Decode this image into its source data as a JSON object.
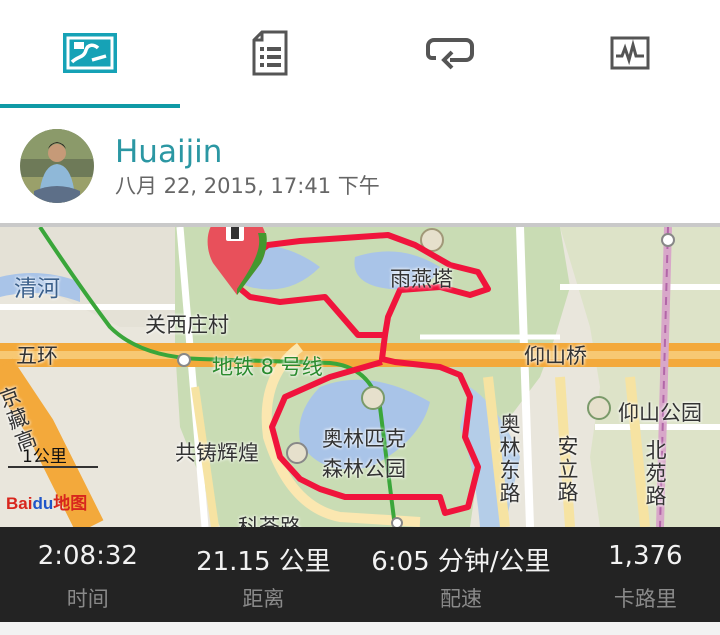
{
  "tabs": [
    {
      "name": "map-tab",
      "icon": "map-icon",
      "active": true
    },
    {
      "name": "details-tab",
      "icon": "document-list-icon",
      "active": false
    },
    {
      "name": "laps-tab",
      "icon": "repeat-icon",
      "active": false
    },
    {
      "name": "chart-tab",
      "icon": "pulse-chart-icon",
      "active": false
    }
  ],
  "header": {
    "user_name": "Huaijin",
    "date": "八月 22, 2015, 17:41 下午"
  },
  "map": {
    "labels": {
      "qinghe": "清河",
      "guanxizhuang": "关西庄村",
      "fifth_ring": "五环",
      "metro8": "地铁 8 号线",
      "yanshanqiao": "仰山桥",
      "yuyanta": "雨燕塔",
      "olympic_park_1": "奥林匹克",
      "olympic_park_2": "森林公园",
      "yangshan_park": "仰山公园",
      "gongzhu": "共铸辉煌",
      "jingzang": "京藏高",
      "aolin_east": "奥林东路",
      "anli": "安立路",
      "beiyuan": "北苑路",
      "kecha": "科荟路"
    },
    "scale": "1公里",
    "provider_logo": "Baidu地图",
    "colors": {
      "route": "#f0143c",
      "metro": "#3aa63a",
      "road": "#f3a93b",
      "pin": "#e8505b"
    }
  },
  "stats": [
    {
      "value": "2:08:32",
      "label": "时间"
    },
    {
      "value": "21.15 公里",
      "label": "距离"
    },
    {
      "value": "6:05 分钟/公里",
      "label": "配速"
    },
    {
      "value": "1,376",
      "label": "卡路里"
    }
  ],
  "accent_color": "#0f9aa6"
}
